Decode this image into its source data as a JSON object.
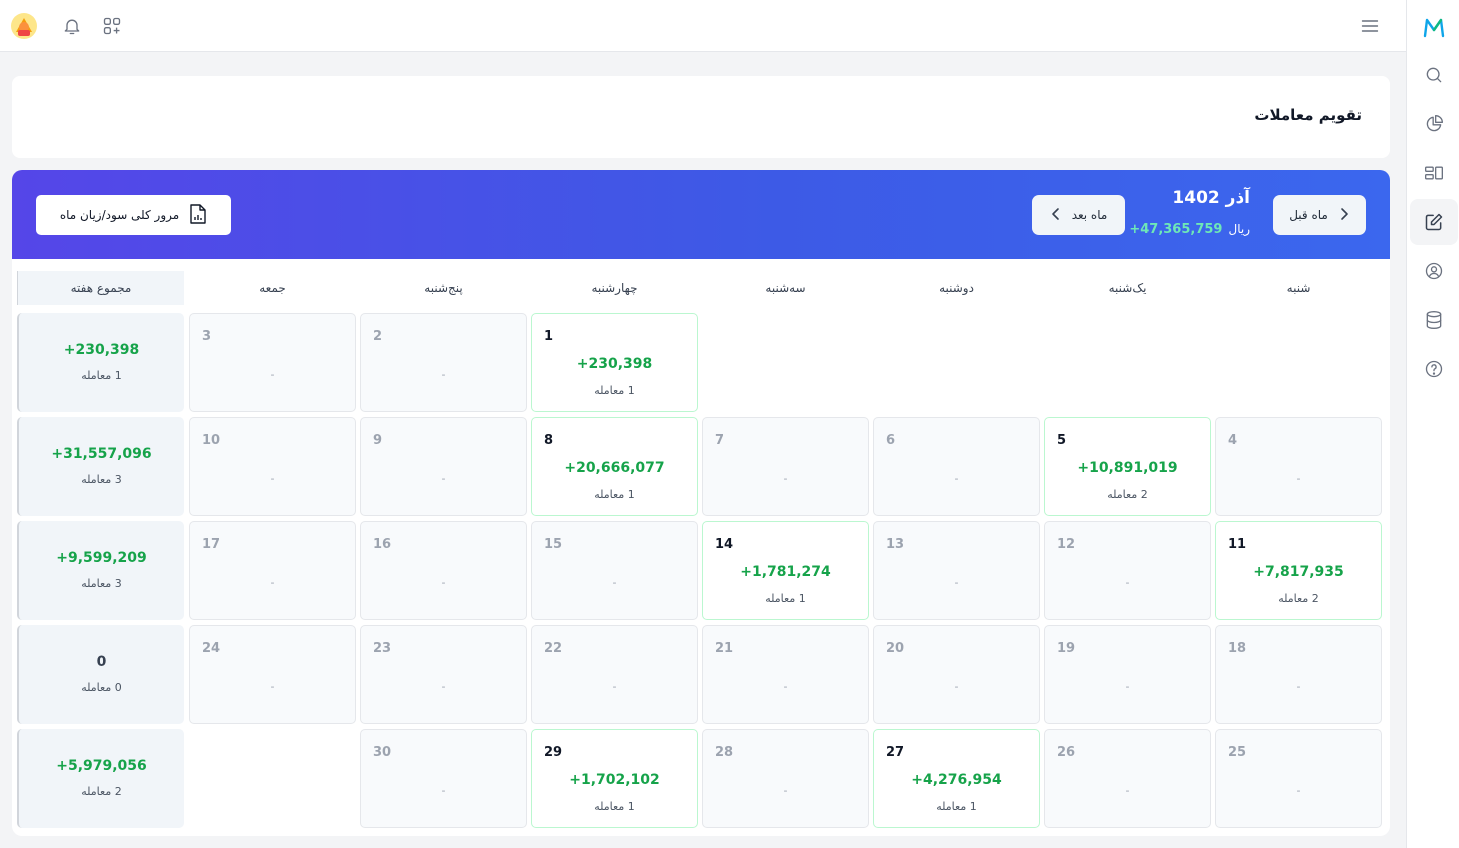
{
  "page": {
    "title": "تقویم معاملات"
  },
  "header": {
    "month_label": "آذر 1402",
    "total_label": "ریال",
    "total_value": "+47,365,759",
    "prev_label": "ماه قبل",
    "next_label": "ماه بعد",
    "overview_label": "مرور کلی سود/زیان ماه"
  },
  "weekdays": [
    "شنبه",
    "یک‌شنبه",
    "دوشنبه",
    "سه‌شنبه",
    "چهارشنبه",
    "پنج‌شنبه",
    "جمعه"
  ],
  "week_total_label": "مجموع هفته",
  "trade_word": "معامله",
  "empty_mark": "-",
  "weeks": [
    {
      "days": [
        null,
        null,
        null,
        null,
        {
          "day": "1",
          "value": "+230,398",
          "count": "1"
        },
        {
          "day": "2"
        },
        {
          "day": "3"
        }
      ],
      "total": {
        "value": "+230,398",
        "count": "1"
      }
    },
    {
      "days": [
        {
          "day": "4"
        },
        {
          "day": "5",
          "value": "+10,891,019",
          "count": "2"
        },
        {
          "day": "6"
        },
        {
          "day": "7"
        },
        {
          "day": "8",
          "value": "+20,666,077",
          "count": "1"
        },
        {
          "day": "9"
        },
        {
          "day": "10"
        }
      ],
      "total": {
        "value": "+31,557,096",
        "count": "3"
      }
    },
    {
      "days": [
        {
          "day": "11",
          "value": "+7,817,935",
          "count": "2"
        },
        {
          "day": "12"
        },
        {
          "day": "13"
        },
        {
          "day": "14",
          "value": "+1,781,274",
          "count": "1"
        },
        {
          "day": "15"
        },
        {
          "day": "16"
        },
        {
          "day": "17"
        }
      ],
      "total": {
        "value": "+9,599,209",
        "count": "3"
      }
    },
    {
      "days": [
        {
          "day": "18"
        },
        {
          "day": "19"
        },
        {
          "day": "20"
        },
        {
          "day": "21"
        },
        {
          "day": "22"
        },
        {
          "day": "23"
        },
        {
          "day": "24"
        }
      ],
      "total": {
        "value": "0",
        "count": "0"
      }
    },
    {
      "days": [
        {
          "day": "25"
        },
        {
          "day": "26"
        },
        {
          "day": "27",
          "value": "+4,276,954",
          "count": "1"
        },
        {
          "day": "28"
        },
        {
          "day": "29",
          "value": "+1,702,102",
          "count": "1"
        },
        {
          "day": "30"
        },
        null
      ],
      "total": {
        "value": "+5,979,056",
        "count": "2"
      }
    }
  ],
  "colors": {
    "accent": "#4f46e5",
    "profit": "#16a34a",
    "brand": "#0ea5e9"
  }
}
